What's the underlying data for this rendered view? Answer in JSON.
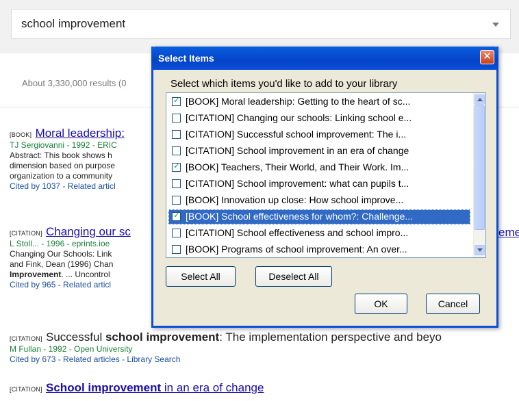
{
  "search": {
    "query": "school improvement",
    "results_count": "About 3,330,000 results (0"
  },
  "results": [
    {
      "tag": "[BOOK]",
      "title": "Moral leadership:",
      "meta": "TJ Sergiovanni - 1992 - ERIC",
      "snippet1": "Abstract: This book shows h",
      "snippet2": "dimension based on purpose",
      "snippet3": "organization to a community",
      "links": "Cited by 1037 - Related articl"
    },
    {
      "tag": "[CITATION]",
      "title": "Changing our sc",
      "title_tail": "eme",
      "meta": "L Stoll... - 1996 - eprints.ioe",
      "snippet1": "Changing Our Schools: Link",
      "snippet2": "and Fink, Dean (1996) Chan",
      "snippet3_bold": "Improvement",
      "snippet3": ". ... Uncontrol",
      "links": "Cited by 965 - Related articl"
    },
    {
      "tag": "[CITATION]",
      "title_pre": "Successful ",
      "title_bold": "school improvement",
      "title_post": ": The implementation perspective and beyo",
      "meta": "M Fullan - 1992 - Open University",
      "links": "Cited by 673 - Related articles - Library Search"
    },
    {
      "tag": "[CITATION]",
      "title_bold": "School improvement",
      "title_post": " in an era of change"
    }
  ],
  "dialog": {
    "title": "Select Items",
    "close_glyph": "✕",
    "prompt": "Select which items you'd like to add to your library",
    "items": [
      {
        "label": "[BOOK] Moral leadership: Getting to the heart of sc...",
        "checked": true
      },
      {
        "label": "[CITATION] Changing our schools: Linking school e...",
        "checked": false
      },
      {
        "label": "[CITATION] Successful school improvement: The i...",
        "checked": false
      },
      {
        "label": "[CITATION] School improvement in an era of change",
        "checked": false
      },
      {
        "label": "[BOOK] Teachers, Their World, and Their Work. Im...",
        "checked": true
      },
      {
        "label": "[CITATION] School improvement: what can pupils t...",
        "checked": false
      },
      {
        "label": "[BOOK] Innovation up close: How school improve...",
        "checked": false
      },
      {
        "label": "[BOOK] School effectiveness for whom?: Challenge...",
        "checked": true,
        "selected": true
      },
      {
        "label": "[CITATION] School effectiveness and school impro...",
        "checked": false
      },
      {
        "label": "[BOOK] Programs of school improvement: An over...",
        "checked": false
      }
    ],
    "select_all": "Select All",
    "deselect_all": "Deselect All",
    "ok": "OK",
    "cancel": "Cancel"
  },
  "colors": {
    "accent": "#0a4ed8",
    "selection": "#316ac5",
    "link": "#1a0dab",
    "meta": "#1a7f37"
  }
}
